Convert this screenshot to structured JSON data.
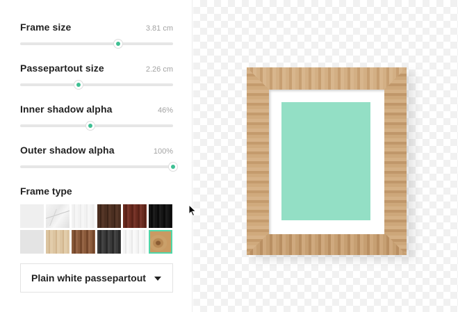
{
  "controls": {
    "frame_size": {
      "label": "Frame size",
      "value": "3.81 cm",
      "level": 0.64
    },
    "passepartout_size": {
      "label": "Passepartout size",
      "value": "2.26 cm",
      "level": 0.38
    },
    "inner_shadow_alpha": {
      "label": "Inner shadow alpha",
      "value": "46%",
      "level": 0.46
    },
    "outer_shadow_alpha": {
      "label": "Outer shadow alpha",
      "value": "100%",
      "level": 1.0
    }
  },
  "frame_type": {
    "title": "Frame type",
    "swatches": [
      "plain-white",
      "white-marble",
      "white-wood",
      "dark-wood",
      "red-wood",
      "black-wood",
      "light-grey",
      "pine-wood",
      "walnut-wood",
      "charcoal-wood",
      "birch-wood",
      "knotted-oak"
    ],
    "selected_index": 11
  },
  "passepartout_select": {
    "label": "Plain white passepartout"
  },
  "colors": {
    "accent": "#3fbf93",
    "selected_outline": "#4fd6a8",
    "artwork": "#93dfc5",
    "frame_wood": "#c9a377",
    "passepartout": "#ffffff"
  },
  "icons": {
    "dropdown": "caret-down-icon",
    "pointer": "mouse-cursor-icon"
  }
}
